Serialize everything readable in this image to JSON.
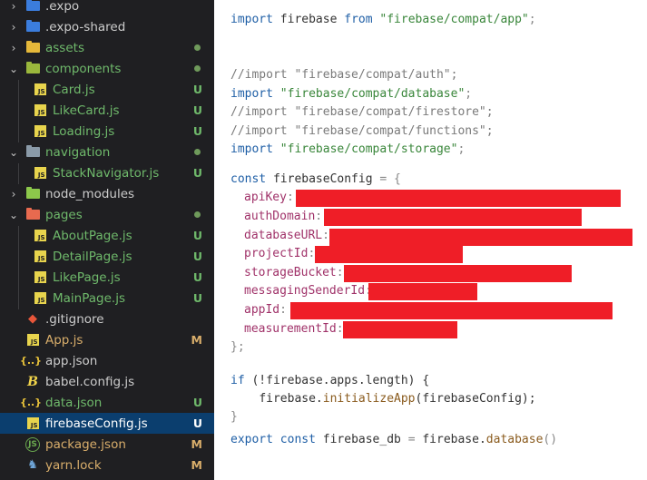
{
  "explorer": {
    "items": [
      {
        "name": "expo-folder-row",
        "label": ".expo",
        "chevron": "right",
        "icon": "expo-folder-icon",
        "badge": ""
      },
      {
        "name": "expo-shared-folder-row",
        "label": ".expo-shared",
        "chevron": "right",
        "icon": "expo-folder-icon",
        "badge": ""
      },
      {
        "name": "assets-folder-row",
        "label": "assets",
        "chevron": "right",
        "icon": "folder-icon",
        "badge": "dot"
      },
      {
        "name": "components-folder-row",
        "label": "components",
        "chevron": "down",
        "icon": "folder-open-icon",
        "badge": "dot"
      },
      {
        "name": "card-js-row",
        "label": "Card.js",
        "icon": "js-file-icon",
        "badge": "U"
      },
      {
        "name": "likecard-js-row",
        "label": "LikeCard.js",
        "icon": "js-file-icon",
        "badge": "U"
      },
      {
        "name": "loading-js-row",
        "label": "Loading.js",
        "icon": "js-file-icon",
        "badge": "U"
      },
      {
        "name": "navigation-folder-row",
        "label": "navigation",
        "chevron": "down",
        "icon": "folder-open-icon",
        "badge": "dot"
      },
      {
        "name": "stacknavigator-js-row",
        "label": "StackNavigator.js",
        "icon": "js-file-icon",
        "badge": "U"
      },
      {
        "name": "node-modules-folder-row",
        "label": "node_modules",
        "chevron": "right",
        "icon": "node-folder-icon",
        "badge": ""
      },
      {
        "name": "pages-folder-row",
        "label": "pages",
        "chevron": "down",
        "icon": "pages-folder-icon",
        "badge": "dot"
      },
      {
        "name": "aboutpage-js-row",
        "label": "AboutPage.js",
        "icon": "js-file-icon",
        "badge": "U"
      },
      {
        "name": "detailpage-js-row",
        "label": "DetailPage.js",
        "icon": "js-file-icon",
        "badge": "U"
      },
      {
        "name": "likepage-js-row",
        "label": "LikePage.js",
        "icon": "js-file-icon",
        "badge": "U"
      },
      {
        "name": "mainpage-js-row",
        "label": "MainPage.js",
        "icon": "js-file-icon",
        "badge": "U"
      },
      {
        "name": "gitignore-row",
        "label": ".gitignore",
        "icon": "git-icon",
        "badge": ""
      },
      {
        "name": "app-js-row",
        "label": "App.js",
        "icon": "js-file-icon",
        "badge": "M"
      },
      {
        "name": "app-json-row",
        "label": "app.json",
        "icon": "json-icon",
        "badge": ""
      },
      {
        "name": "babel-config-row",
        "label": "babel.config.js",
        "icon": "babel-icon",
        "badge": ""
      },
      {
        "name": "data-json-row",
        "label": "data.json",
        "icon": "json-icon",
        "badge": "U"
      },
      {
        "name": "firebaseconfig-js-row",
        "label": "firebaseConfig.js",
        "icon": "js-file-icon",
        "badge": "U",
        "selected": true
      },
      {
        "name": "package-json-row",
        "label": "package.json",
        "icon": "npm-icon",
        "badge": "M"
      },
      {
        "name": "yarn-lock-row",
        "label": "yarn.lock",
        "icon": "yarn-icon",
        "badge": "M"
      }
    ]
  },
  "code": {
    "l1": {
      "kw1": "import",
      "id": " firebase ",
      "kw2": "from",
      "sp": " ",
      "str": "\"firebase/compat/app\"",
      "end": ";"
    },
    "l2": "//import \"firebase/compat/auth\";",
    "l3": {
      "kw": "import",
      "sp": " ",
      "str": "\"firebase/compat/database\"",
      "end": ";"
    },
    "l4": "//import \"firebase/compat/firestore\";",
    "l5": "//import \"firebase/compat/functions\";",
    "l6": {
      "kw": "import",
      "sp": " ",
      "str": "\"firebase/compat/storage\"",
      "end": ";"
    },
    "l7": {
      "kw": "const",
      "id": " firebaseConfig ",
      "op": "=",
      "brace": " {"
    },
    "props": [
      "apiKey",
      "authDomain",
      "databaseURL",
      "projectId",
      "storageBucket",
      "messagingSenderId",
      "appId",
      "measurementId"
    ],
    "colon": ":",
    "close": "};",
    "l8": {
      "kw": "if",
      "a": " (!firebase.apps.length) {"
    },
    "l9": {
      "indent": "    ",
      "obj": "firebase.",
      "fn": "initializeApp",
      "args": "(firebaseConfig);"
    },
    "l10": "}",
    "l11": {
      "kw1": "export",
      "kw2": " const",
      "id": " firebase_db ",
      "op": "=",
      "obj": " firebase.",
      "fn": "database",
      "end": "()"
    }
  },
  "colors": {
    "selection": "#0b3e6e",
    "untracked": "#6fb96b",
    "modified": "#d9ae6b",
    "redaction": "#ef1e27",
    "keyword": "#1f5fa6",
    "string": "#39863a",
    "property": "#a03269"
  }
}
